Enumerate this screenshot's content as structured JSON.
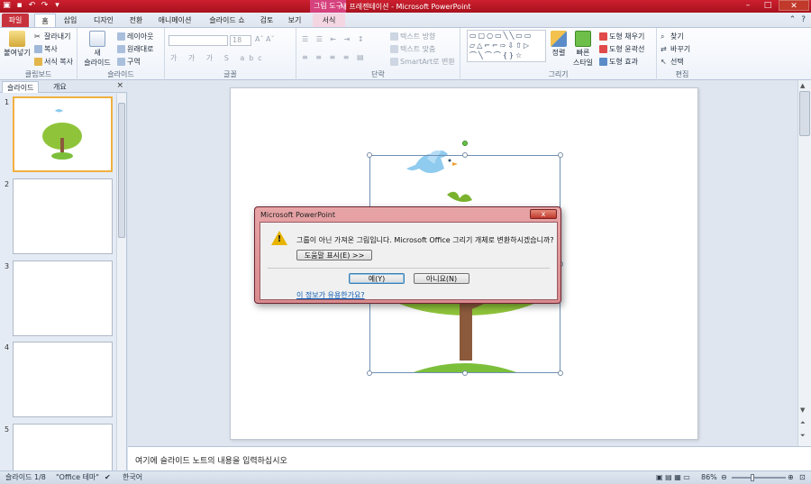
{
  "titlebar": {
    "title": "새 프레젠테이션 - Microsoft PowerPoint",
    "context_group": "그림 도구"
  },
  "tabs": [
    "파일",
    "홈",
    "삽입",
    "디자인",
    "전환",
    "애니메이션",
    "슬라이드 쇼",
    "검토",
    "보기",
    "서식"
  ],
  "ribbon": {
    "clipboard": {
      "paste": "붙여넣기",
      "cut": "잘라내기",
      "copy": "복사",
      "format_painter": "서식 복사",
      "label": "클립보드"
    },
    "slides": {
      "new_slide_1": "새",
      "new_slide_2": "슬라이드",
      "layout": "레이아웃",
      "reset": "원래대로",
      "section": "구역",
      "label": "슬라이드"
    },
    "font": {
      "size": "18",
      "label": "글꼴"
    },
    "paragraph": {
      "text_direction": "텍스트 방향",
      "align_text": "텍스트 맞춤",
      "smartart": "SmartArt로 변환",
      "label": "단락"
    },
    "drawing": {
      "arrange": "정렬",
      "quick_styles_1": "빠른",
      "quick_styles_2": "스타일",
      "shape_fill": "도형 채우기",
      "shape_outline": "도형 윤곽선",
      "shape_effects": "도형 효과",
      "label": "그리기"
    },
    "editing": {
      "find": "찾기",
      "replace": "바꾸기",
      "select": "선택",
      "label": "편집"
    }
  },
  "leftpane": {
    "tab_slides": "슬라이드",
    "tab_outline": "개요",
    "close": "×",
    "thumbnails": [
      "1",
      "2",
      "3",
      "4",
      "5"
    ]
  },
  "notes": {
    "placeholder": "여기에 슬라이드 노트의 내용을 입력하십시오"
  },
  "statusbar": {
    "slide": "슬라이드 1/8",
    "theme": "\"Office 테마\"",
    "language": "한국어",
    "zoom": "86%"
  },
  "dialog": {
    "title": "Microsoft PowerPoint",
    "close": "x",
    "message": "그룹이 아닌 가져온 그림입니다. Microsoft Office 그리기 개체로 변환하시겠습니까?",
    "show_help": "도움말 표시(E) >>",
    "yes": "예(Y)",
    "no": "아니요(N)",
    "link": "이 정보가 유용한가요?"
  },
  "colors": {
    "title_bar": "#b8192a",
    "context_tab": "#d6427d",
    "tree_leaves": "#8fc43a",
    "tree_trunk": "#8b5a3c",
    "bird": "#8fcbee",
    "grass": "#7cbf3a"
  }
}
